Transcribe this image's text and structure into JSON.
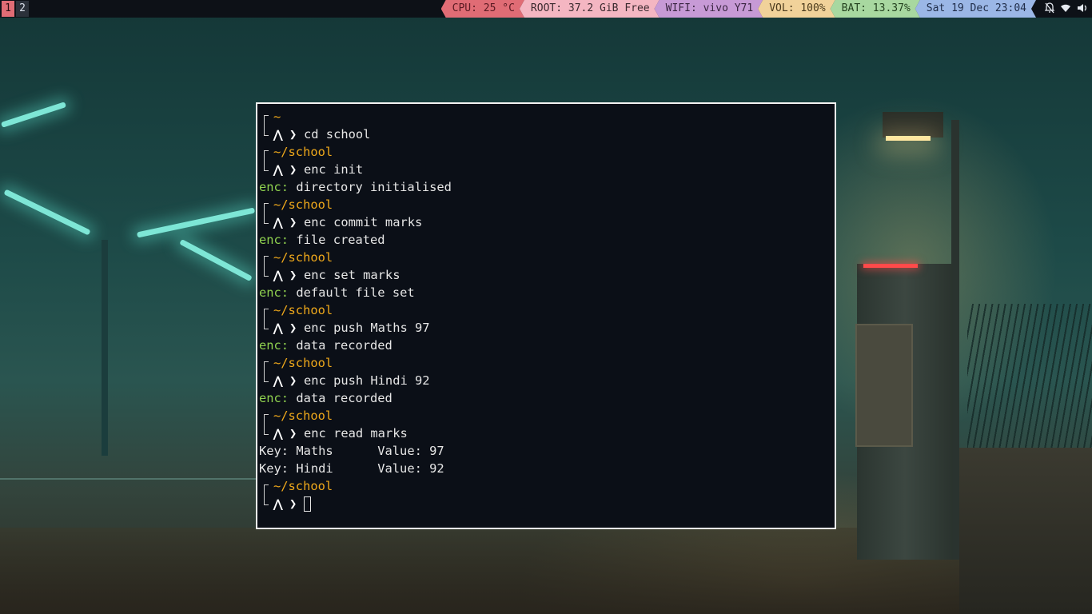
{
  "workspaces": [
    "1",
    "2"
  ],
  "status": {
    "cpu": "CPU: 25 °C",
    "root": "ROOT: 37.2 GiB Free",
    "wifi": "WIFI: vivo Y71",
    "vol": "VOL: 100%",
    "bat": "BAT: 13.37%",
    "datetime": "Sat 19 Dec 23:04"
  },
  "colors": {
    "cpu": "#e06c75",
    "root": "#f4b6c2",
    "wifi": "#c79ad6",
    "vol": "#f1d29a",
    "bat": "#a8d8a0",
    "datetime": "#9bb7e6"
  },
  "tray_icons": [
    "notifications-off-icon",
    "wifi-icon",
    "volume-icon"
  ],
  "terminal": {
    "home_path": "~",
    "path": "~/school",
    "prompt_symbol": "❯",
    "cmd1": "cd school",
    "cmd2": "enc init",
    "out2": "directory initialised",
    "cmd3": "enc commit marks",
    "out3": "file created",
    "cmd4": "enc set marks",
    "out4": "default file set",
    "cmd5": "enc push Maths 97",
    "out5": "data recorded",
    "cmd6": "enc push Hindi 92",
    "out6": "data recorded",
    "cmd7": "enc read marks",
    "read_row1": "Key: Maths      Value: 97",
    "read_row2": "Key: Hindi      Value: 92",
    "enc_prefix": "enc:"
  }
}
